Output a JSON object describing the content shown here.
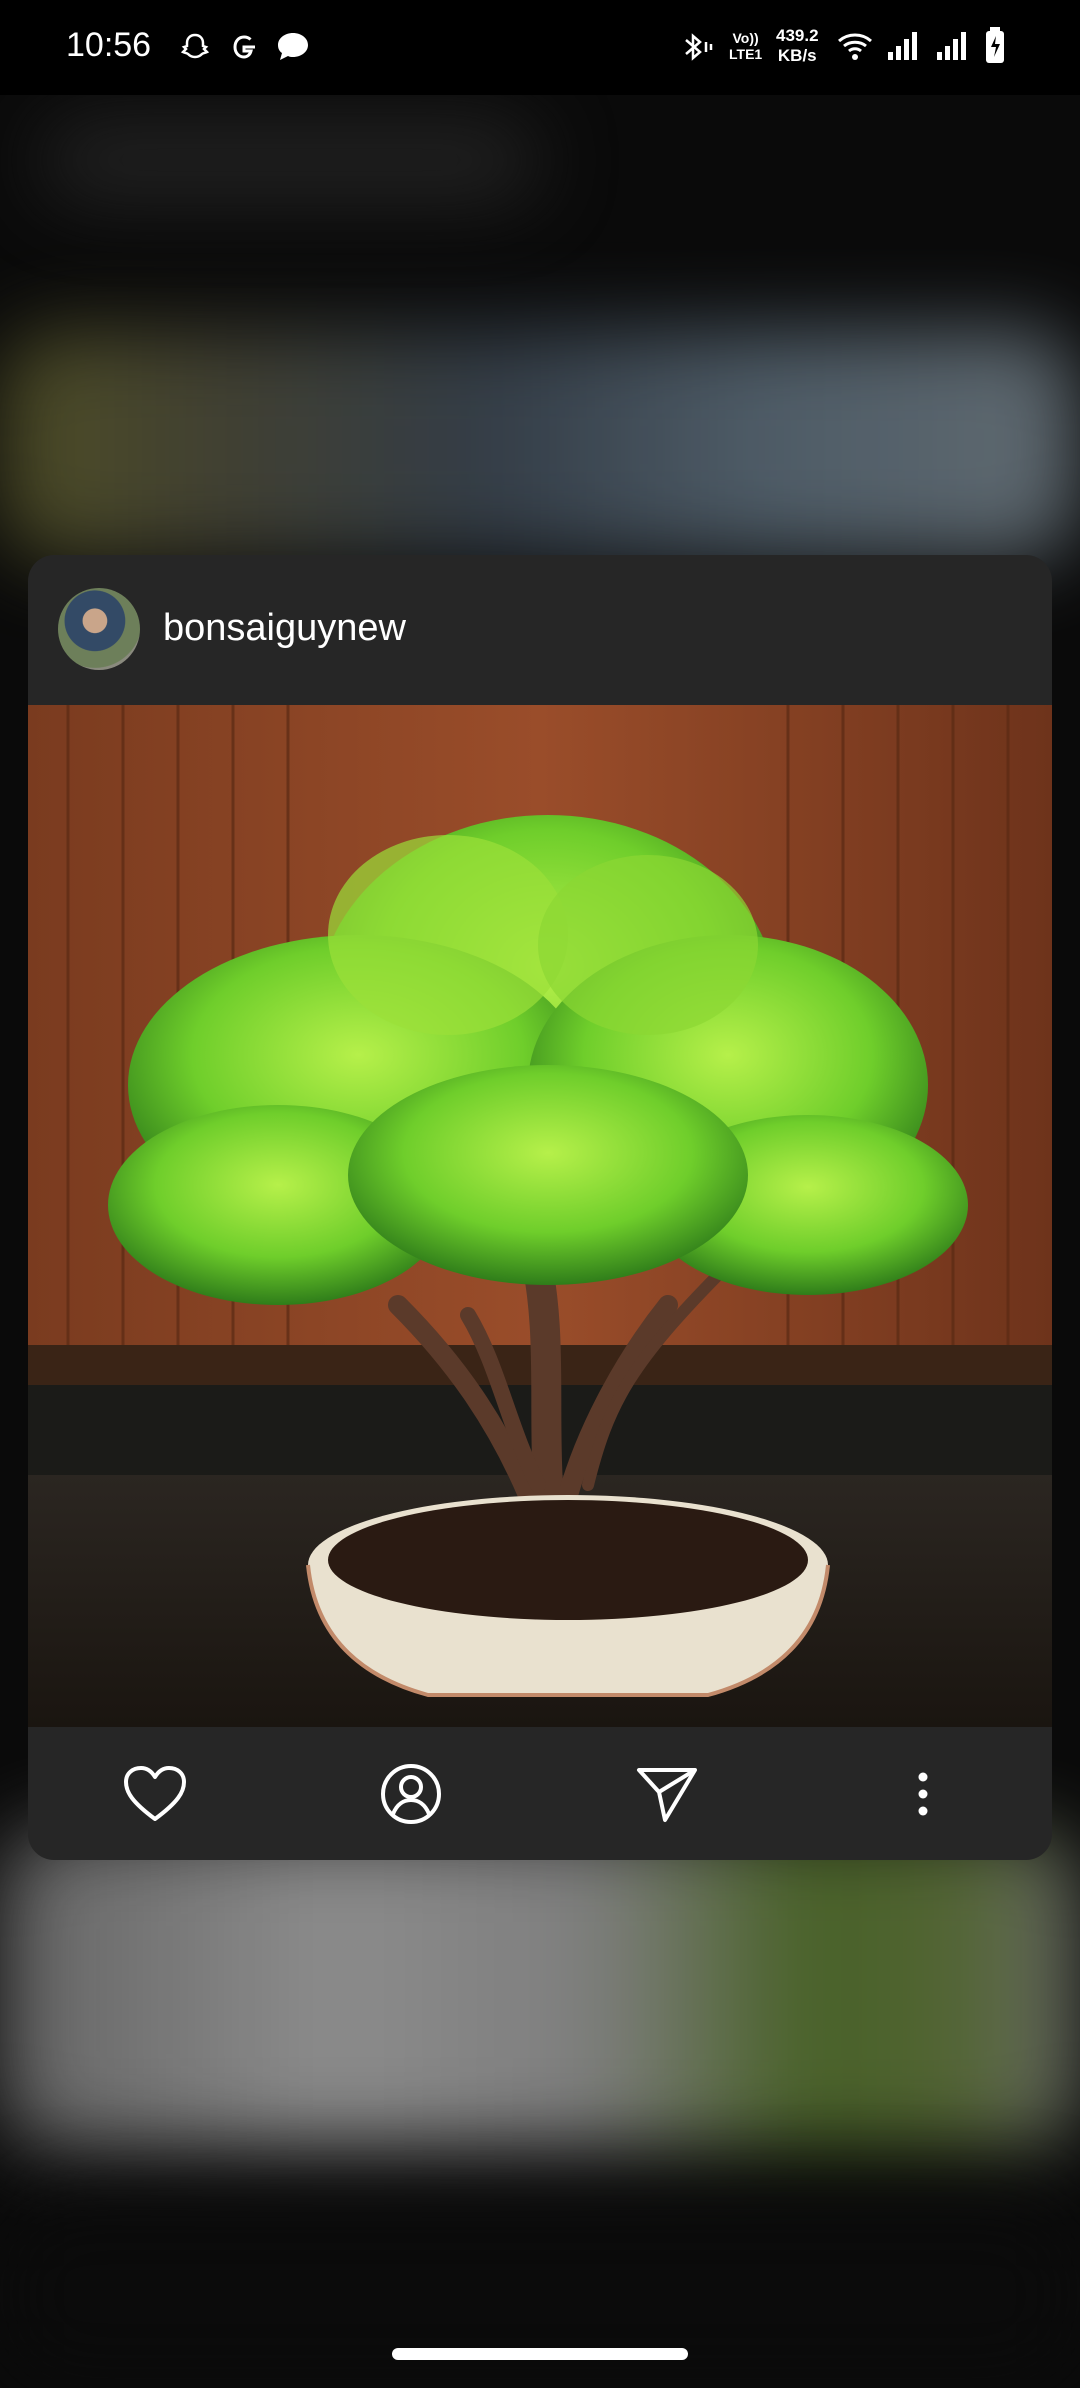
{
  "status_bar": {
    "time": "10:56",
    "lte_top": "Vo))",
    "lte_bottom": "LTE1",
    "net_rate_value": "439.2",
    "net_rate_unit": "KB/s",
    "icons": [
      "snapchat-icon",
      "google-icon",
      "message-icon",
      "bluetooth-icon",
      "wifi-icon",
      "signal-icon",
      "signal-icon",
      "battery-charging-icon"
    ]
  },
  "post": {
    "username": "bonsaiguynew",
    "image_description_icon": "bonsai-photo",
    "actions": [
      "heart-icon",
      "profile-icon",
      "send-icon",
      "more-icon"
    ]
  },
  "colors": {
    "card_bg": "#262626",
    "page_bg": "#0a0a0a"
  }
}
